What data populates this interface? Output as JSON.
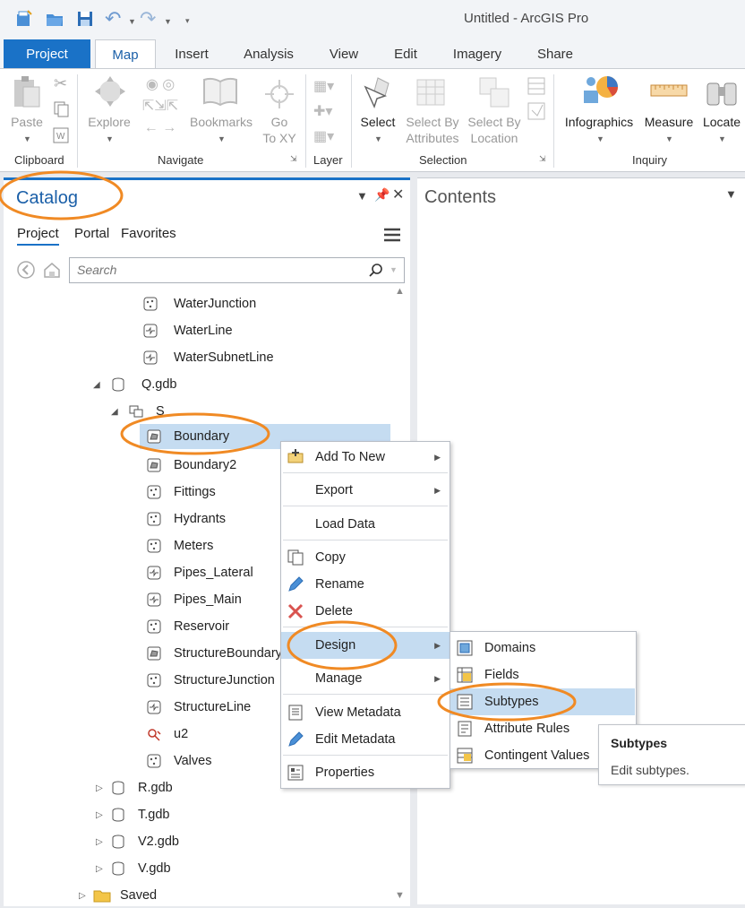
{
  "app": {
    "title": "Untitled - ArcGIS Pro"
  },
  "tabs": [
    "Project",
    "Map",
    "Insert",
    "Analysis",
    "View",
    "Edit",
    "Imagery",
    "Share"
  ],
  "ribbon": {
    "paste": "Paste",
    "explore": "Explore",
    "bookmarks": "Bookmarks",
    "goto_1": "Go",
    "goto_2": "To XY",
    "select": "Select",
    "select_attr_1": "Select By",
    "select_attr_2": "Attributes",
    "select_loc_1": "Select By",
    "select_loc_2": "Location",
    "infographics": "Infographics",
    "measure": "Measure",
    "locate": "Locate",
    "groups": {
      "clipboard": "Clipboard",
      "navigate": "Navigate",
      "layer": "Layer",
      "selection": "Selection",
      "inquiry": "Inquiry"
    }
  },
  "catalog": {
    "title": "Catalog",
    "tabs": [
      "Project",
      "Portal",
      "Favorites"
    ],
    "search_placeholder": "Search",
    "tree": [
      "WaterJunction",
      "WaterLine",
      "WaterSubnetLine",
      "Q.gdb",
      "S",
      "Boundary",
      "Boundary2",
      "Fittings",
      "Hydrants",
      "Meters",
      "Pipes_Lateral",
      "Pipes_Main",
      "Reservoir",
      "StructureBoundary",
      "StructureJunction",
      "StructureLine",
      "u2",
      "Valves",
      "R.gdb",
      "T.gdb",
      "V2.gdb",
      "V.gdb",
      "Saved"
    ]
  },
  "contents": {
    "title": "Contents"
  },
  "context_menu": [
    "Add To New",
    "Export",
    "Load Data",
    "Copy",
    "Rename",
    "Delete",
    "Design",
    "Manage",
    "View Metadata",
    "Edit Metadata",
    "Properties"
  ],
  "design_submenu": [
    "Domains",
    "Fields",
    "Subtypes",
    "Attribute Rules",
    "Contingent Values"
  ],
  "tooltip": {
    "title": "Subtypes",
    "text": "Edit subtypes."
  },
  "colors": {
    "accent": "#1a72c7",
    "highlight": "#c5dcf1",
    "annotation": "#f08a24"
  }
}
